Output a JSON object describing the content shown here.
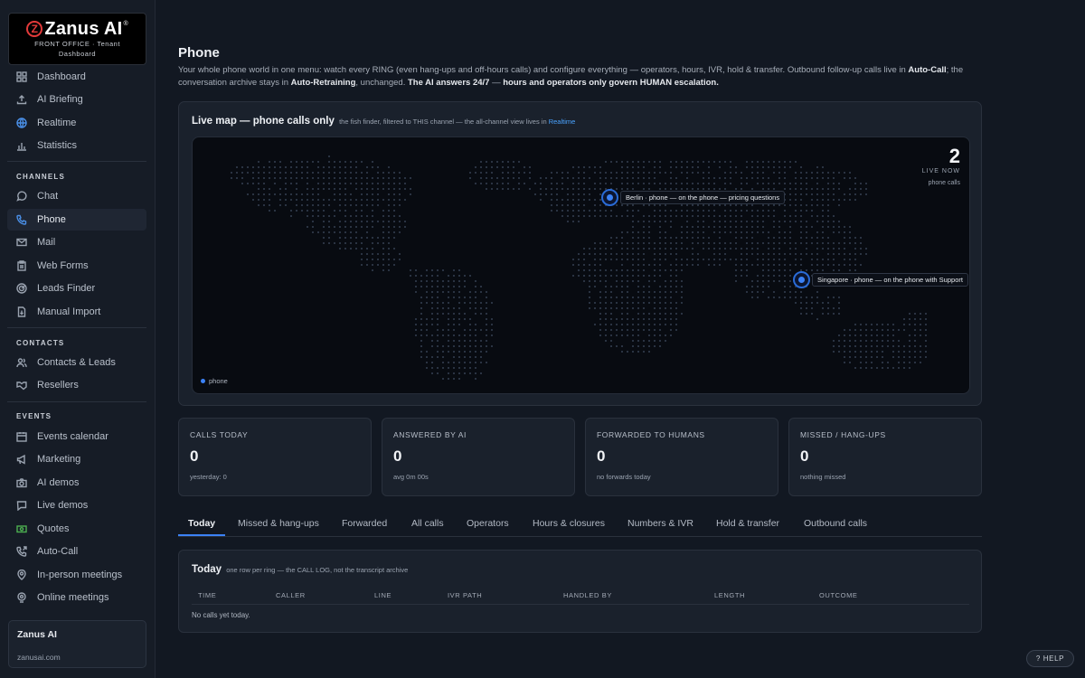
{
  "brand": {
    "name": "Zanus AI",
    "logo_mark": "Z",
    "registered": "®",
    "subtitle_line1": "FRONT OFFICE · Tenant",
    "subtitle_line2": "Dashboard"
  },
  "sidebar": {
    "top_items": [
      {
        "label": "Dashboard",
        "icon": "grid-icon"
      },
      {
        "label": "AI Briefing",
        "icon": "upload-icon"
      },
      {
        "label": "Realtime",
        "icon": "globe-icon"
      },
      {
        "label": "Statistics",
        "icon": "bar-chart-icon"
      }
    ],
    "channels_title": "CHANNELS",
    "channels": [
      {
        "label": "Chat",
        "icon": "chat-bubble-icon"
      },
      {
        "label": "Phone",
        "icon": "phone-icon",
        "active": true
      },
      {
        "label": "Mail",
        "icon": "mail-icon"
      },
      {
        "label": "Web Forms",
        "icon": "clipboard-icon"
      },
      {
        "label": "Leads Finder",
        "icon": "radar-icon"
      },
      {
        "label": "Manual Import",
        "icon": "file-import-icon"
      }
    ],
    "contacts_title": "CONTACTS",
    "contacts": [
      {
        "label": "Contacts & Leads",
        "icon": "users-icon"
      },
      {
        "label": "Resellers",
        "icon": "handshake-icon"
      }
    ],
    "events_title": "EVENTS",
    "events": [
      {
        "label": "Events calendar",
        "icon": "calendar-icon"
      },
      {
        "label": "Marketing",
        "icon": "megaphone-icon"
      },
      {
        "label": "AI demos",
        "icon": "camera-icon"
      },
      {
        "label": "Live demos",
        "icon": "chat-icon"
      },
      {
        "label": "Quotes",
        "icon": "money-icon"
      },
      {
        "label": "Auto-Call",
        "icon": "phone-forward-icon"
      },
      {
        "label": "In-person meetings",
        "icon": "map-pin-icon"
      },
      {
        "label": "Online meetings",
        "icon": "video-pin-icon"
      }
    ],
    "tenant": {
      "name": "Zanus AI",
      "url": "zanusai.com"
    }
  },
  "page": {
    "title": "Phone",
    "desc_1": "Your whole phone world in one menu: watch every RING (even hang-ups and off-hours calls) and configure everything — operators, hours, IVR, hold & transfer. Outbound follow-up calls live in ",
    "desc_b1": "Auto-Call",
    "desc_2": "; the conversation archive stays in ",
    "desc_b2": "Auto-Retraining",
    "desc_3": ", unchanged. ",
    "desc_b3": "The AI answers 24/7",
    "desc_4": " — ",
    "desc_b4": "hours and operators only govern HUMAN escalation."
  },
  "live_map": {
    "title": "Live map — phone calls only",
    "subtitle_prefix": "the fish finder, filtered to THIS channel — the all-channel view lives in ",
    "subtitle_link": "Realtime",
    "live_count": "2",
    "live_label": "LIVE NOW",
    "live_sub": "phone calls",
    "pins": [
      {
        "label": "Berlin · phone — on the phone — pricing questions"
      },
      {
        "label": "Singapore · phone — on the phone with Support"
      }
    ],
    "legend_label": "phone",
    "accent": "#3b82f6"
  },
  "stats": [
    {
      "label": "CALLS TODAY",
      "value": "0",
      "sub": "yesterday: 0"
    },
    {
      "label": "ANSWERED BY AI",
      "value": "0",
      "sub": "avg 0m 00s"
    },
    {
      "label": "FORWARDED TO HUMANS",
      "value": "0",
      "sub": "no forwards today"
    },
    {
      "label": "MISSED / HANG-UPS",
      "value": "0",
      "sub": "nothing missed"
    }
  ],
  "tabs": [
    {
      "label": "Today",
      "active": true
    },
    {
      "label": "Missed & hang-ups"
    },
    {
      "label": "Forwarded"
    },
    {
      "label": "All calls"
    },
    {
      "label": "Operators"
    },
    {
      "label": "Hours & closures"
    },
    {
      "label": "Numbers & IVR"
    },
    {
      "label": "Hold & transfer"
    },
    {
      "label": "Outbound calls"
    }
  ],
  "call_log": {
    "title": "Today",
    "subtitle": "one row per ring — the CALL LOG, not the transcript archive",
    "columns": [
      "TIME",
      "CALLER",
      "LINE",
      "IVR PATH",
      "HANDLED BY",
      "LENGTH",
      "OUTCOME"
    ],
    "empty_text": "No calls yet today."
  },
  "help_label": "? HELP"
}
